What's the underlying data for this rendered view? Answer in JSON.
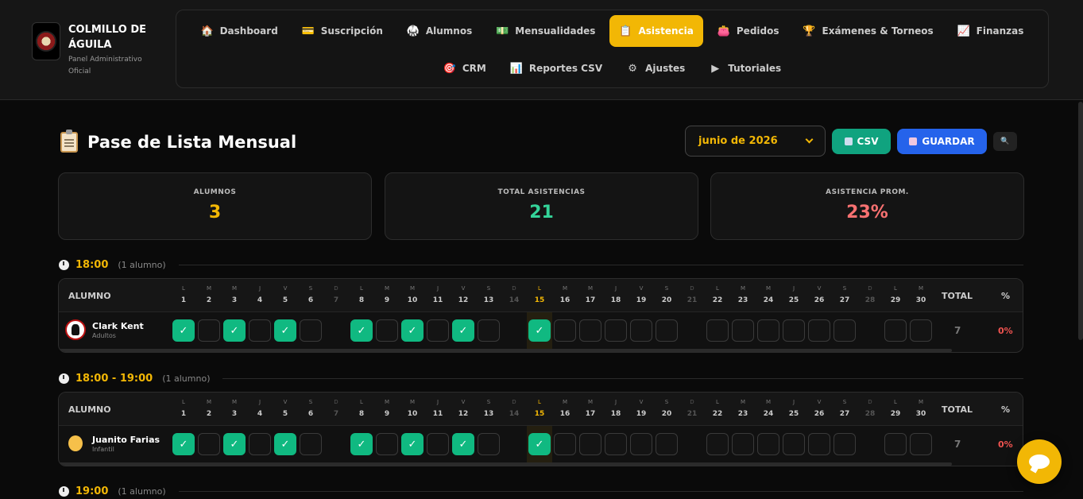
{
  "brand": {
    "title": "COLMILLO DE ÁGUILA",
    "subtitle": "Panel Administrativo Oficial"
  },
  "nav": {
    "row1": [
      {
        "label": "Dashboard",
        "icon": "🏠"
      },
      {
        "label": "Suscripción",
        "icon": "💳"
      },
      {
        "label": "Alumnos",
        "icon": "🥋"
      },
      {
        "label": "Mensualidades",
        "icon": "💵"
      },
      {
        "label": "Asistencia",
        "icon": "📋",
        "active": true
      },
      {
        "label": "Pedidos",
        "icon": "👛"
      },
      {
        "label": "Exámenes & Torneos",
        "icon": "🏆"
      },
      {
        "label": "Finanzas",
        "icon": "📈"
      }
    ],
    "row2": [
      {
        "label": "CRM",
        "icon": "🎯"
      },
      {
        "label": "Reportes CSV",
        "icon": "📊"
      },
      {
        "label": "Ajustes",
        "icon": "⚙"
      },
      {
        "label": "Tutoriales",
        "icon": "▶"
      }
    ]
  },
  "page": {
    "title": "Pase de Lista Mensual",
    "month": "junio de 2026",
    "csv_label": "CSV",
    "save_label": "GUARDAR"
  },
  "stats": [
    {
      "label": "ALUMNOS",
      "value": "3",
      "color": "#f2b705"
    },
    {
      "label": "TOTAL ASISTENCIAS",
      "value": "21",
      "color": "#34d399"
    },
    {
      "label": "ASISTENCIA PROM.",
      "value": "23%",
      "color": "#f87171"
    }
  ],
  "table": {
    "col_alumno": "ALUMNO",
    "col_total": "TOTAL",
    "col_pct": "%",
    "today": 15,
    "days": [
      {
        "l": "L",
        "n": "1"
      },
      {
        "l": "M",
        "n": "2"
      },
      {
        "l": "M",
        "n": "3"
      },
      {
        "l": "J",
        "n": "4"
      },
      {
        "l": "V",
        "n": "5"
      },
      {
        "l": "S",
        "n": "6"
      },
      {
        "l": "D",
        "n": "7",
        "we": true
      },
      {
        "l": "L",
        "n": "8"
      },
      {
        "l": "M",
        "n": "9"
      },
      {
        "l": "M",
        "n": "10"
      },
      {
        "l": "J",
        "n": "11"
      },
      {
        "l": "V",
        "n": "12"
      },
      {
        "l": "S",
        "n": "13"
      },
      {
        "l": "D",
        "n": "14",
        "we": true
      },
      {
        "l": "L",
        "n": "15"
      },
      {
        "l": "M",
        "n": "16"
      },
      {
        "l": "M",
        "n": "17"
      },
      {
        "l": "J",
        "n": "18"
      },
      {
        "l": "V",
        "n": "19"
      },
      {
        "l": "S",
        "n": "20"
      },
      {
        "l": "D",
        "n": "21",
        "we": true
      },
      {
        "l": "L",
        "n": "22"
      },
      {
        "l": "M",
        "n": "23"
      },
      {
        "l": "M",
        "n": "24"
      },
      {
        "l": "J",
        "n": "25"
      },
      {
        "l": "V",
        "n": "26"
      },
      {
        "l": "S",
        "n": "27"
      },
      {
        "l": "D",
        "n": "28",
        "we": true
      },
      {
        "l": "L",
        "n": "29"
      },
      {
        "l": "M",
        "n": "30"
      }
    ]
  },
  "sections": [
    {
      "time": "18:00",
      "count": "(1 alumno)",
      "students": [
        {
          "name": "Clark Kent",
          "group": "Adultos",
          "avatar": "adult",
          "present": [
            1,
            3,
            5,
            8,
            10,
            12,
            15
          ],
          "total": "7",
          "pct": "0%"
        }
      ]
    },
    {
      "time": "18:00 - 19:00",
      "count": "(1 alumno)",
      "students": [
        {
          "name": "Juanito Farias",
          "group": "Infantil",
          "avatar": "kid",
          "present": [
            1,
            3,
            5,
            8,
            10,
            12,
            15
          ],
          "total": "7",
          "pct": "0%"
        }
      ]
    },
    {
      "time": "19:00",
      "count": "(1 alumno)",
      "students": []
    }
  ],
  "check_mark": "✓",
  "search_icon": "🔍"
}
